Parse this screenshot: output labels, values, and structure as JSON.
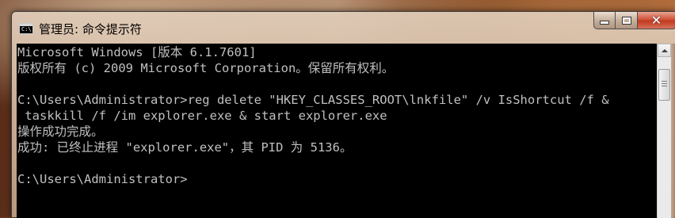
{
  "window": {
    "title": "管理员: 命令提示符",
    "icon_text": "C:\\"
  },
  "controls": {
    "minimize": "minimize",
    "maximize": "maximize",
    "close": "✕"
  },
  "console": {
    "lines": [
      "Microsoft Windows [版本 6.1.7601]",
      "版权所有 (c) 2009 Microsoft Corporation。保留所有权利。",
      "",
      "C:\\Users\\Administrator>reg delete \"HKEY_CLASSES_ROOT\\lnkfile\" /v IsShortcut /f &",
      " taskkill /f /im explorer.exe & start explorer.exe",
      "操作成功完成。",
      "成功: 已终止进程 \"explorer.exe\"，其 PID 为 5136。",
      "",
      "C:\\Users\\Administrator>"
    ]
  },
  "colors": {
    "console_bg": "#000000",
    "console_fg": "#c0c0c0",
    "close_button": "#c23a1f"
  },
  "icons": {
    "app": "cmd-icon",
    "minimize": "minimize-icon",
    "maximize": "maximize-icon",
    "close": "close-icon",
    "scroll_up": "arrow-up-icon"
  }
}
